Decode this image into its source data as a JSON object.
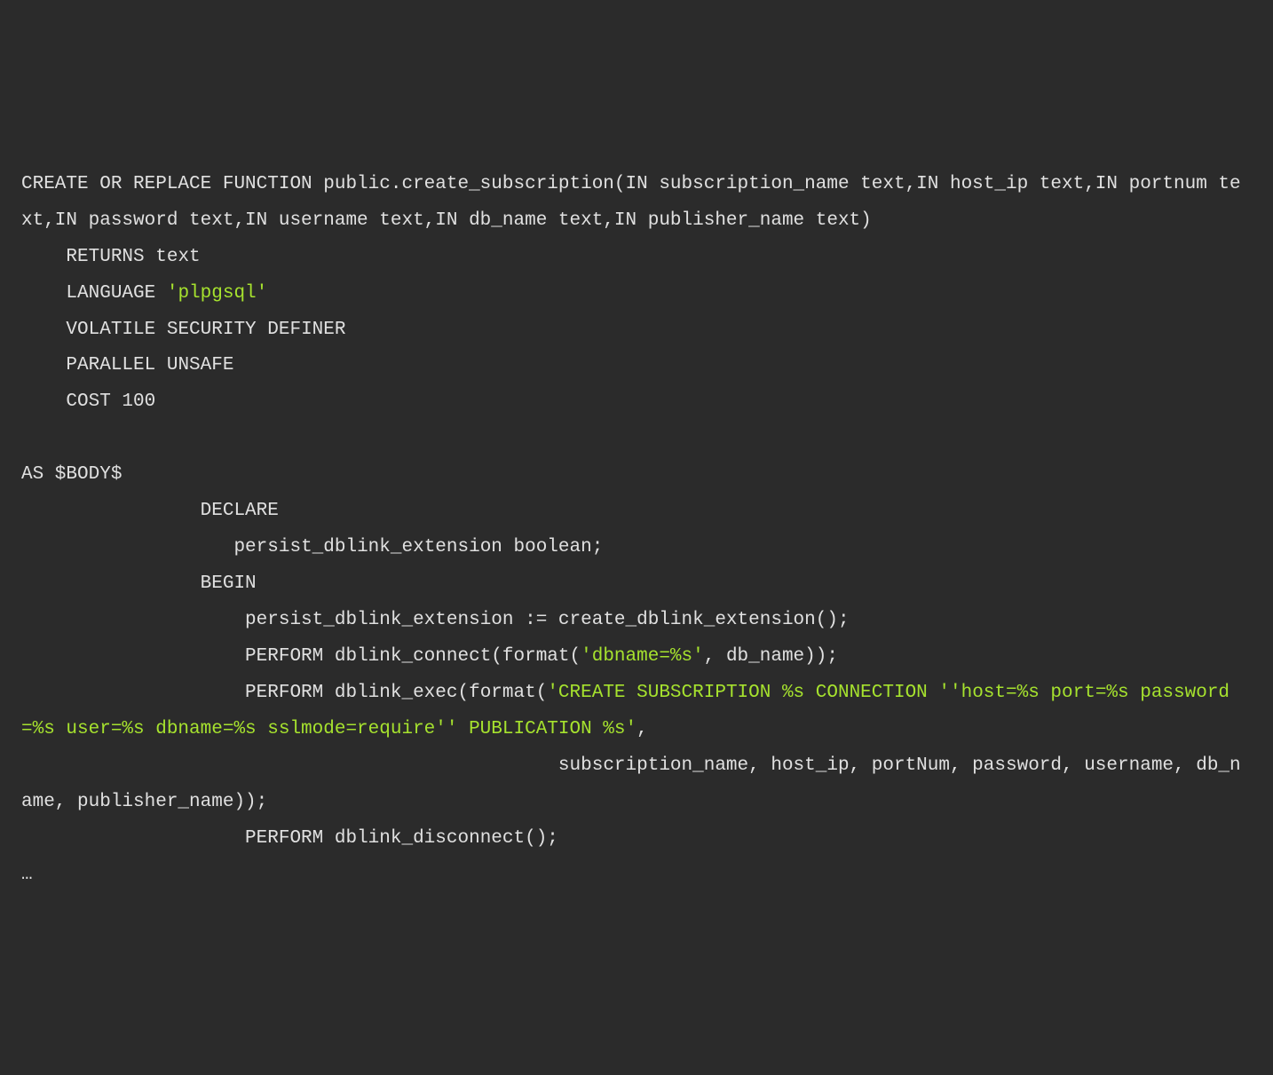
{
  "code": {
    "line1_pre": "CREATE OR REPLACE FUNCTION public.create_subscription(IN subscription_name text,IN host_ip text,IN portnum text,IN password text,IN username text,IN db_name text,IN publisher_name text)",
    "line2": "    RETURNS text",
    "line3_pre": "    LANGUAGE ",
    "line3_str": "'plpgsql'",
    "line4": "    VOLATILE SECURITY DEFINER",
    "line5": "    PARALLEL UNSAFE",
    "line6": "    COST 100",
    "line7": "",
    "line8": "AS $BODY$",
    "line9": "                DECLARE",
    "line10": "                   persist_dblink_extension boolean;",
    "line11": "                BEGIN",
    "line12": "                    persist_dblink_extension := create_dblink_extension();",
    "line13_pre": "                    PERFORM dblink_connect(format(",
    "line13_str": "'dbname=%s'",
    "line13_post": ", db_name));",
    "line14_pre": "                    PERFORM dblink_exec(format(",
    "line14_str": "'CREATE SUBSCRIPTION %s CONNECTION ''host=%s port=%s password=%s user=%s dbname=%s sslmode=require'' PUBLICATION %s'",
    "line14_post": ",",
    "line15": "                                                subscription_name, host_ip, portNum, password, username, db_name, publisher_name));",
    "line16": "                    PERFORM dblink_disconnect();",
    "ellipsis": "…"
  }
}
